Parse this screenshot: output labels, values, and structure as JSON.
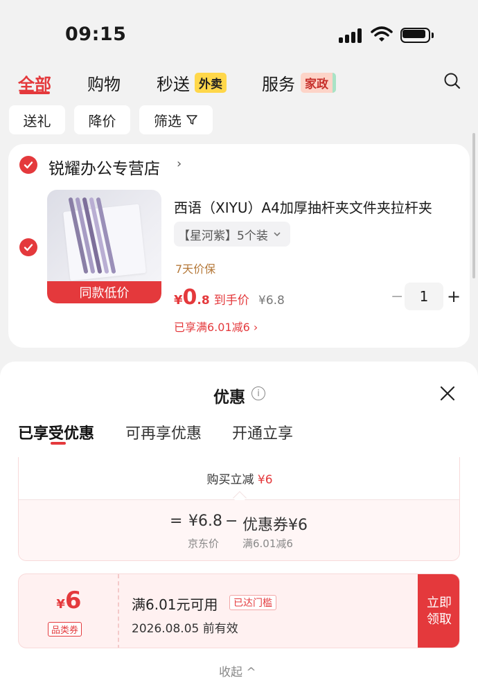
{
  "status_bar": {
    "time": "09:15"
  },
  "tabs": {
    "all": "全部",
    "shopping": "购物",
    "instant": "秒送",
    "instant_tag": "外卖",
    "service": "服务",
    "service_tag": "家政"
  },
  "filters": {
    "gift": "送礼",
    "price_drop": "降价",
    "filter": "筛选"
  },
  "cart": {
    "shop_name": "锐耀办公专营店",
    "shop_arrow": "›",
    "product": {
      "title": "西语（XIYU）A4加厚抽杆夹文件夹拉杆夹",
      "image_badge": "同款低价",
      "spec": "【星河紫】5个装",
      "guarantee": "7天价保",
      "price_symbol": "¥",
      "price_int": "0",
      "price_dec": ".8",
      "price_label": "到手价",
      "original_price": "¥6.8",
      "promo": "已享满6.01减6 ›",
      "quantity": "1",
      "minus": "−",
      "plus": "+"
    }
  },
  "sheet": {
    "title": "优惠",
    "info": "i",
    "tabs": [
      "已享受优惠",
      "可再享优惠",
      "开通立享"
    ],
    "calc": {
      "top_label": "购买立减",
      "top_amount": "¥6",
      "equals": "=",
      "jd_price": "¥6.8",
      "minus": "−",
      "coupon_part": "优惠券¥6",
      "jd_price_label": "京东价",
      "coupon_label": "满6.01减6"
    },
    "coupon": {
      "symbol": "¥",
      "amount": "6",
      "type": "品类券",
      "condition": "满6.01元可用",
      "flag": "已达门槛",
      "expiry": "2026.08.05 前有效",
      "button": "立即领取"
    },
    "collapse": "收起 ^"
  },
  "colors": {
    "accent": "#e4393c",
    "guarantee": "#b5793a",
    "tag_yellow": "#ffd74a"
  }
}
